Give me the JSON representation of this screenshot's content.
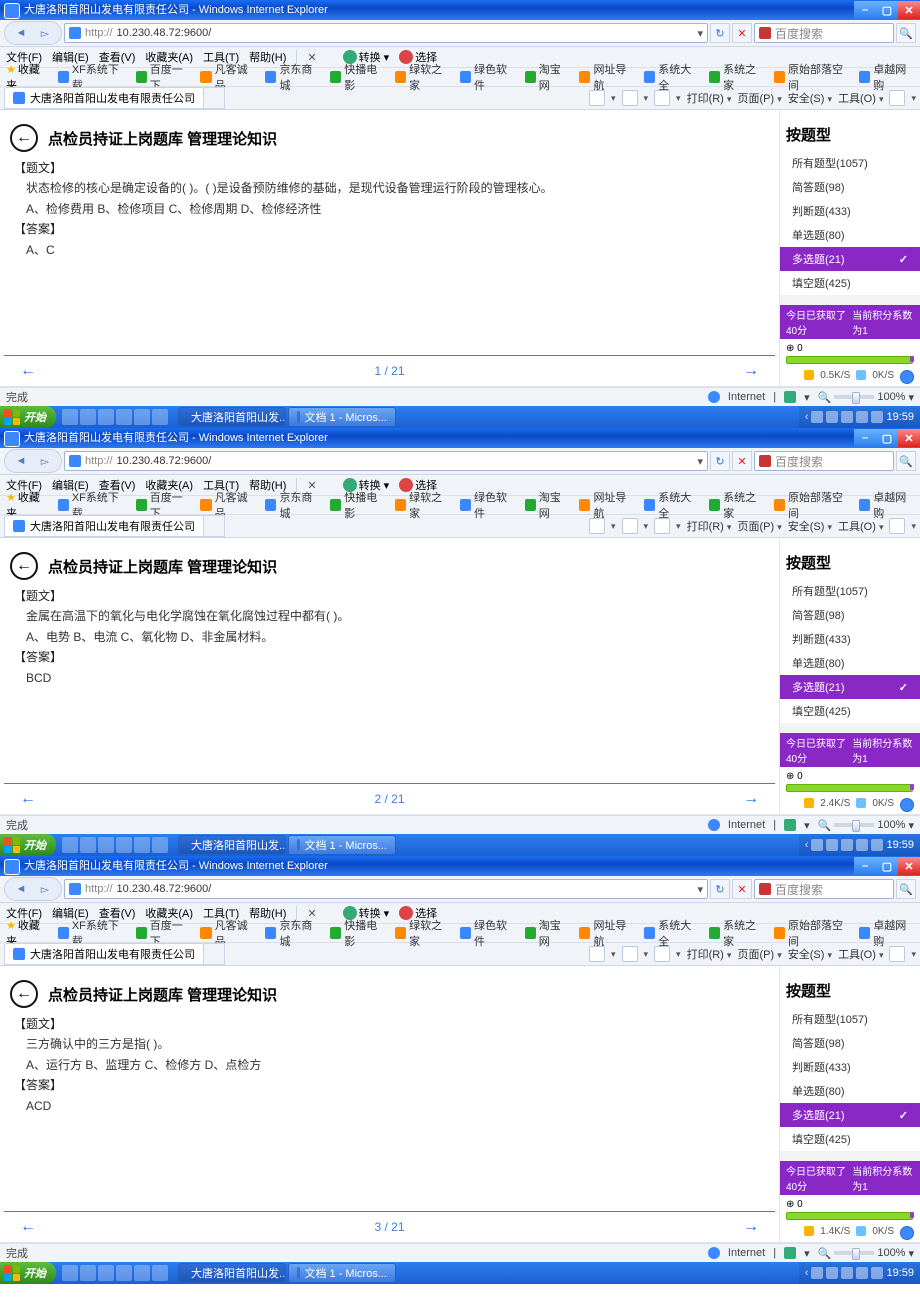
{
  "browser": {
    "title_suffix": " - Windows Internet Explorer",
    "title": "大唐洛阳首阳山发电有限责任公司",
    "url_prefix": "http://",
    "url": "10.230.48.72:9600/",
    "search_placeholder": "百度搜索",
    "menu": [
      "文件(F)",
      "编辑(E)",
      "查看(V)",
      "收藏夹(A)",
      "工具(T)",
      "帮助(H)"
    ],
    "menu_extra": [
      "转换",
      "选择"
    ],
    "fav_label": "收藏夹",
    "bookmarks": [
      "XF系统下载",
      "百度一下",
      "凡客诚品",
      "京东商城",
      "快播电影",
      "绿软之家",
      "绿色软件",
      "淘宝网",
      "网址导航",
      "系统大全",
      "系统之家",
      "原始部落空间",
      "卓越网购"
    ],
    "tab_title": "大唐洛阳首阳山发电有限责任公司",
    "cmdbar": [
      "打印(R)",
      "页面(P)",
      "安全(S)",
      "工具(O)"
    ],
    "status_done": "完成",
    "zone": "Internet",
    "zoom": "100%"
  },
  "app": {
    "header_title": "点检员持证上岗题库 管理理论知识",
    "filter_title": "按题型",
    "filters": [
      "所有题型(1057)",
      "简答题(98)",
      "判断题(433)",
      "单选题(80)",
      "多选题(21)",
      "填空题(425)"
    ],
    "filter_selected_index": 4,
    "q_label": "【题文】",
    "a_label": "【答案】"
  },
  "points": {
    "left": "今日已获取了40分",
    "right_prefix": "当前积分系数为",
    "right_value": "1",
    "gauge_min": "0"
  },
  "taskbar": {
    "start": "开始",
    "tasks": [
      {
        "label": "大唐洛阳首阳山发...",
        "cls": "ie"
      },
      {
        "label": "文档 1 - Micros...",
        "cls": "word"
      }
    ],
    "clock": "19:59"
  },
  "instances": [
    {
      "question": "状态检修的核心是确定设备的(     )。(     )是设备预防维修的基础，是现代设备管理运行阶段的管理核心。",
      "options": "A、检修费用    B、检修项目    C、检修周期    D、检修经济性",
      "answer": "A、C",
      "pager": "1 / 21",
      "speed_down": "0.5K/S",
      "speed_up": "0K/S"
    },
    {
      "question": "金属在高温下的氧化与电化学腐蚀在氧化腐蚀过程中都有(     )。",
      "options": "A、电势    B、电流    C、氧化物    D、非金属材料。",
      "answer": "BCD",
      "pager": "2 / 21",
      "speed_down": "2.4K/S",
      "speed_up": "0K/S"
    },
    {
      "question": "三方确认中的三方是指(     )。",
      "options": "A、运行方    B、监理方    C、检修方    D、点检方",
      "answer": "ACD",
      "pager": "3 / 21",
      "speed_down": "1.4K/S",
      "speed_up": "0K/S"
    }
  ]
}
